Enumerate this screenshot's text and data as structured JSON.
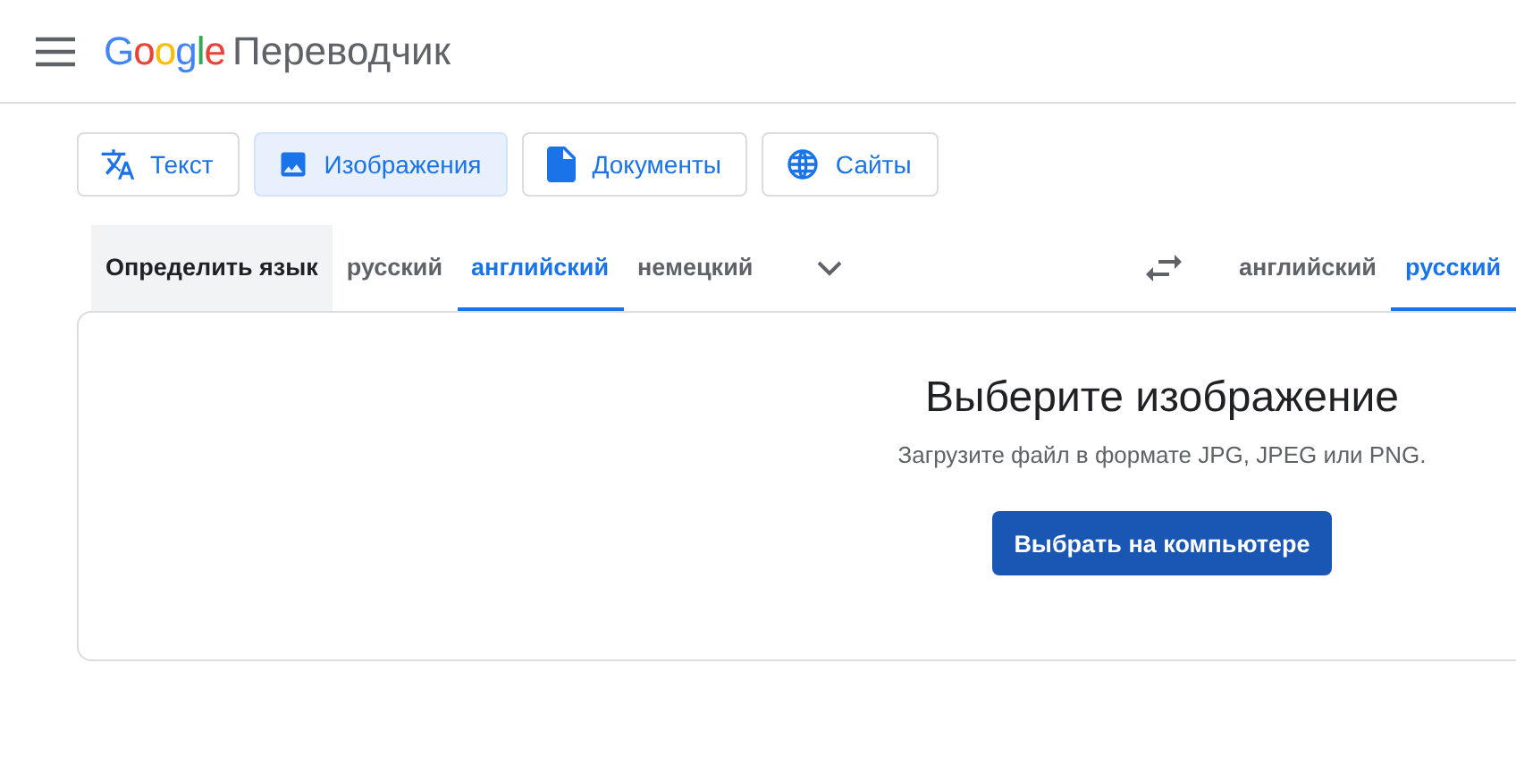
{
  "header": {
    "logo": "Google",
    "product": "Переводчик"
  },
  "modes": [
    {
      "label": "Текст",
      "kind": "text",
      "selected": false
    },
    {
      "label": "Изображения",
      "kind": "image",
      "selected": true
    },
    {
      "label": "Документы",
      "kind": "document",
      "selected": false
    },
    {
      "label": "Сайты",
      "kind": "site",
      "selected": false
    }
  ],
  "source_languages": [
    {
      "label": "Определить язык",
      "selected": false,
      "kind": "detect"
    },
    {
      "label": "русский",
      "selected": false
    },
    {
      "label": "английский",
      "selected": true
    },
    {
      "label": "немецкий",
      "selected": false
    }
  ],
  "target_languages": [
    {
      "label": "английский",
      "selected": false
    },
    {
      "label": "русский",
      "selected": true
    }
  ],
  "upload": {
    "title": "Выберите изображение",
    "hint": "Загрузите файл в формате JPG, JPEG или PNG.",
    "button": "Выбрать на компьютере"
  }
}
